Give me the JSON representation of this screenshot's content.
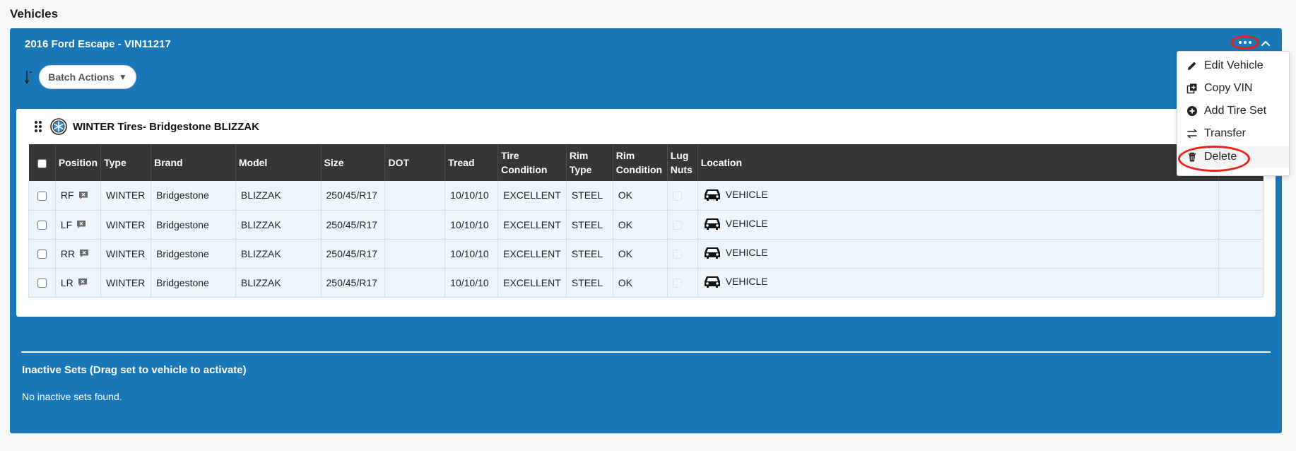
{
  "page": {
    "heading": "Vehicles"
  },
  "vehicle": {
    "title": "2016 Ford Escape - VIN11217",
    "batch_actions_label": "Batch Actions",
    "batch_actions_caret": "▼"
  },
  "tire_set": {
    "title": "WINTER Tires- Bridgestone BLIZZAK",
    "columns": [
      [
        "Position"
      ],
      [
        "Type"
      ],
      [
        "Brand"
      ],
      [
        "Model"
      ],
      [
        "Size"
      ],
      [
        "DOT"
      ],
      [
        "Tread"
      ],
      [
        "Tire",
        "Condition"
      ],
      [
        "Rim",
        "Type"
      ],
      [
        "Rim",
        "Condition"
      ],
      [
        "Lug",
        "Nuts"
      ],
      [
        "Location"
      ]
    ],
    "rows": [
      {
        "position": "RF",
        "type": "WINTER",
        "brand": "Bridgestone",
        "model": "BLIZZAK",
        "size": "250/45/R17",
        "dot": "",
        "tread": "10/10/10",
        "tire_condition": "EXCELLENT",
        "rim_type": "STEEL",
        "rim_condition": "OK",
        "location": "VEHICLE"
      },
      {
        "position": "LF",
        "type": "WINTER",
        "brand": "Bridgestone",
        "model": "BLIZZAK",
        "size": "250/45/R17",
        "dot": "",
        "tread": "10/10/10",
        "tire_condition": "EXCELLENT",
        "rim_type": "STEEL",
        "rim_condition": "OK",
        "location": "VEHICLE"
      },
      {
        "position": "RR",
        "type": "WINTER",
        "brand": "Bridgestone",
        "model": "BLIZZAK",
        "size": "250/45/R17",
        "dot": "",
        "tread": "10/10/10",
        "tire_condition": "EXCELLENT",
        "rim_type": "STEEL",
        "rim_condition": "OK",
        "location": "VEHICLE"
      },
      {
        "position": "LR",
        "type": "WINTER",
        "brand": "Bridgestone",
        "model": "BLIZZAK",
        "size": "250/45/R17",
        "dot": "",
        "tread": "10/10/10",
        "tire_condition": "EXCELLENT",
        "rim_type": "STEEL",
        "rim_condition": "OK",
        "location": "VEHICLE"
      }
    ]
  },
  "inactive": {
    "title": "Inactive Sets (Drag set to vehicle to activate)",
    "empty_text": "No inactive sets found."
  },
  "menu": {
    "items": [
      {
        "label": "Edit Vehicle",
        "icon": "pencil-icon"
      },
      {
        "label": "Copy VIN",
        "icon": "copy-icon"
      },
      {
        "label": "Add Tire Set",
        "icon": "plus-circle-icon"
      },
      {
        "label": "Transfer",
        "icon": "transfer-icon"
      },
      {
        "label": "Delete",
        "icon": "trash-icon"
      }
    ]
  },
  "colors": {
    "panel_blue": "#1a78b8",
    "table_header": "#363636",
    "row_background": "#eef6fd",
    "annotation_red": "#e5231b"
  }
}
